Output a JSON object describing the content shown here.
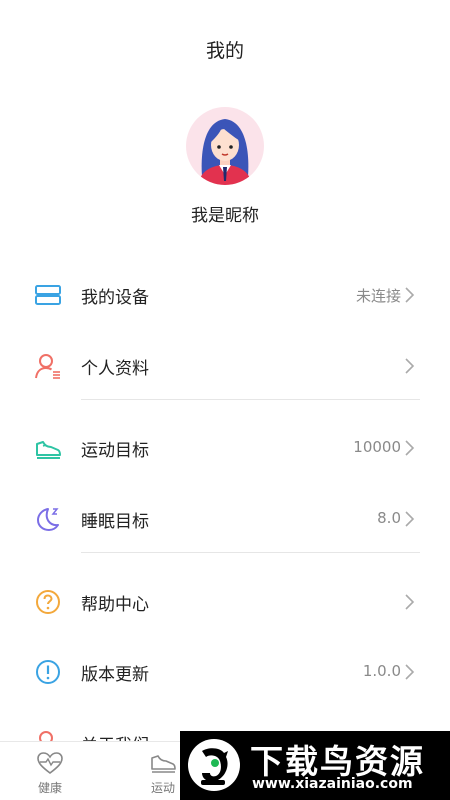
{
  "header": {
    "title": "我的"
  },
  "profile": {
    "nickname": "我是昵称",
    "avatar_icon": "girl-avatar"
  },
  "menu": [
    {
      "label": "我的设备",
      "value": "未连接",
      "icon": "device-icon",
      "color": "#3aa3e3"
    },
    {
      "label": "个人资料",
      "value": "",
      "icon": "person-icon",
      "color": "#f07066"
    },
    {
      "label": "运动目标",
      "value": "10000",
      "icon": "sneaker-icon",
      "color": "#2ec4a4"
    },
    {
      "label": "睡眠目标",
      "value": "8.0",
      "icon": "moon-icon",
      "color": "#7b6ee6"
    },
    {
      "label": "帮助中心",
      "value": "",
      "icon": "question-icon",
      "color": "#f3a83b"
    },
    {
      "label": "版本更新",
      "value": "1.0.0",
      "icon": "exclamation-icon",
      "color": "#3aa3e3"
    },
    {
      "label": "关于我们",
      "value": "",
      "icon": "about-icon",
      "color": "#f07066"
    }
  ],
  "tabbar": [
    {
      "label": "健康",
      "icon": "heart-pulse-icon"
    },
    {
      "label": "运动",
      "icon": "sneaker-icon"
    }
  ],
  "watermark": {
    "title": "下载鸟资源",
    "url": "www.xiazainiao.com"
  }
}
